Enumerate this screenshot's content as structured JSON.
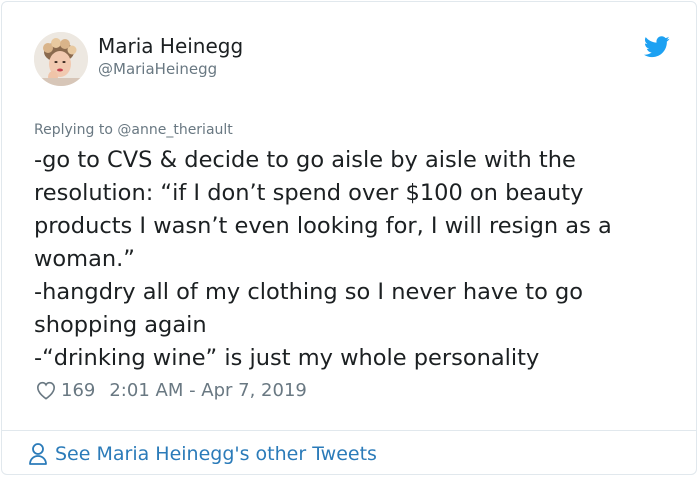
{
  "user": {
    "name": "Maria Heinegg",
    "handle": "@MariaHeinegg"
  },
  "reply": {
    "prefix": "Replying to",
    "mention": "@anne_theriault"
  },
  "tweet": {
    "lines": [
      "-go to CVS & decide to go aisle by aisle with the",
      "resolution: “if I don’t spend over $100 on beauty",
      "products I wasn’t even looking for, I will resign as a",
      "woman.”",
      "-hangdry all of my clothing so I never have to go",
      "shopping again",
      "-“drinking wine” is just my whole personality"
    ]
  },
  "meta": {
    "likes": "169",
    "timestamp": "2:01 AM - Apr 7, 2019"
  },
  "footer": {
    "link_label": "See Maria Heinegg's other Tweets"
  },
  "colors": {
    "twitter_blue": "#1da1f2",
    "link_blue": "#2b7bb9",
    "muted_gray": "#697882",
    "border": "#e1e8ed"
  },
  "icons": {
    "brand": "twitter-bird-icon",
    "like": "heart-icon",
    "profile": "person-icon"
  }
}
